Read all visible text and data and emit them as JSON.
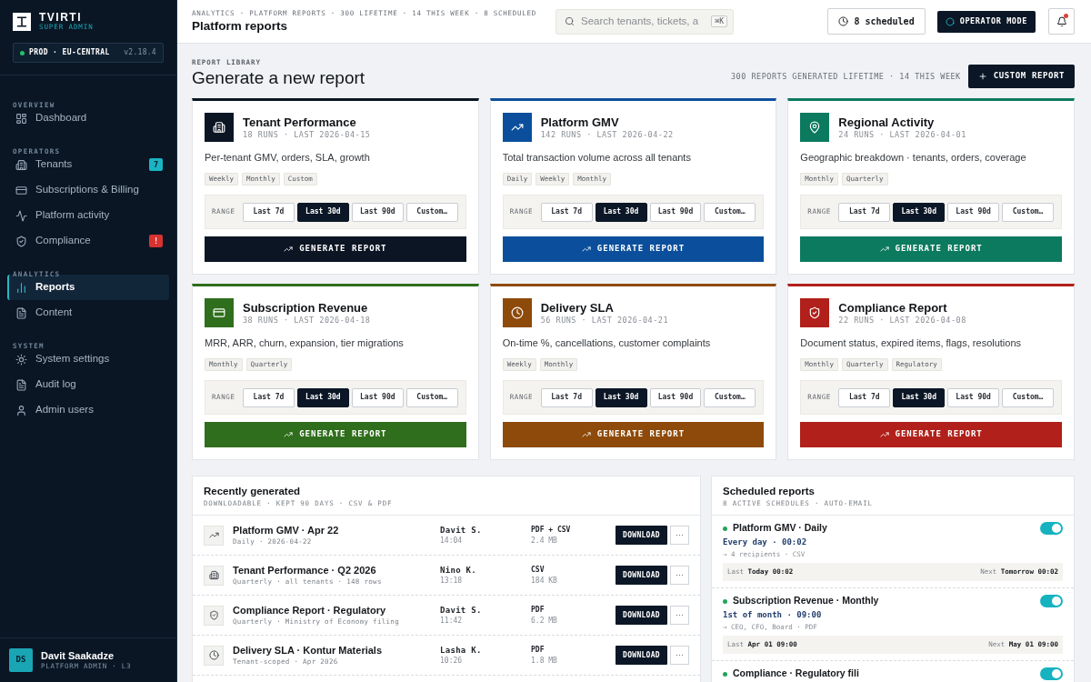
{
  "sidebar": {
    "brand": {
      "name": "TVIRTI",
      "role": "SUPER ADMIN"
    },
    "environment": {
      "name": "PROD · EU-CENTRAL",
      "version": "v2.18.4"
    },
    "sections": [
      {
        "title": "OVERVIEW",
        "items": [
          {
            "label": "Dashboard",
            "selected": false
          }
        ]
      },
      {
        "title": "OPERATORS",
        "items": [
          {
            "label": "Tenants",
            "selected": false,
            "badge": {
              "text": "7",
              "kind": "count"
            }
          },
          {
            "label": "Subscriptions & Billing",
            "selected": false
          },
          {
            "label": "Platform activity",
            "selected": false
          },
          {
            "label": "Compliance",
            "selected": false,
            "badge": {
              "text": "!",
              "kind": "alert"
            }
          }
        ]
      },
      {
        "title": "ANALYTICS",
        "items": [
          {
            "label": "Reports",
            "selected": true
          },
          {
            "label": "Content",
            "selected": false
          }
        ]
      },
      {
        "title": "SYSTEM",
        "items": [
          {
            "label": "System settings",
            "selected": false
          },
          {
            "label": "Audit log",
            "selected": false
          },
          {
            "label": "Admin users",
            "selected": false
          }
        ]
      }
    ],
    "user": {
      "initials": "DS",
      "name": "Davit Saakadze",
      "role": "PLATFORM ADMIN · L3"
    }
  },
  "header": {
    "breadcrumb": "ANALYTICS · PLATFORM REPORTS · 300 LIFETIME · 14 THIS WEEK · 8 SCHEDULED",
    "title": "Platform reports",
    "search": {
      "placeholder": "Search tenants, tickets, a",
      "shortcut": "⌘K"
    },
    "scheduled_button": "8 scheduled",
    "mode_button": "OPERATOR MODE",
    "notifications": {
      "unread": true
    }
  },
  "library": {
    "eyebrow": "REPORT LIBRARY",
    "title": "Generate a new report",
    "summary": "300 REPORTS GENERATED LIFETIME · 14 THIS WEEK",
    "custom_button": "CUSTOM REPORT"
  },
  "report_cards": [
    {
      "title": "Tenant Performance",
      "meta": "18 RUNS · LAST 2026-04-15",
      "description": "Per-tenant GMV, orders, SLA, growth",
      "tags": [
        "Weekly",
        "Monthly",
        "Custom"
      ],
      "color": "#0b1524",
      "range_label": "RANGE",
      "ranges": [
        {
          "label": "Last 7d",
          "selected": false
        },
        {
          "label": "Last 30d",
          "selected": true
        },
        {
          "label": "Last 90d",
          "selected": false
        },
        {
          "label": "Custom…",
          "selected": false
        }
      ],
      "button": "GENERATE REPORT"
    },
    {
      "title": "Platform GMV",
      "meta": "142 RUNS · LAST 2026-04-22",
      "description": "Total transaction volume across all tenants",
      "tags": [
        "Daily",
        "Weekly",
        "Monthly"
      ],
      "color": "#0b4f9c",
      "range_label": "RANGE",
      "ranges": [
        {
          "label": "Last 7d",
          "selected": false
        },
        {
          "label": "Last 30d",
          "selected": true
        },
        {
          "label": "Last 90d",
          "selected": false
        },
        {
          "label": "Custom…",
          "selected": false
        }
      ],
      "button": "GENERATE REPORT"
    },
    {
      "title": "Regional Activity",
      "meta": "24 RUNS · LAST 2026-04-01",
      "description": "Geographic breakdown · tenants, orders, coverage",
      "tags": [
        "Monthly",
        "Quarterly"
      ],
      "color": "#0b7a5f",
      "range_label": "RANGE",
      "ranges": [
        {
          "label": "Last 7d",
          "selected": false
        },
        {
          "label": "Last 30d",
          "selected": true
        },
        {
          "label": "Last 90d",
          "selected": false
        },
        {
          "label": "Custom…",
          "selected": false
        }
      ],
      "button": "GENERATE REPORT"
    },
    {
      "title": "Subscription Revenue",
      "meta": "38 RUNS · LAST 2026-04-18",
      "description": "MRR, ARR, churn, expansion, tier migrations",
      "tags": [
        "Monthly",
        "Quarterly"
      ],
      "color": "#2f6e1c",
      "range_label": "RANGE",
      "ranges": [
        {
          "label": "Last 7d",
          "selected": false
        },
        {
          "label": "Last 30d",
          "selected": true
        },
        {
          "label": "Last 90d",
          "selected": false
        },
        {
          "label": "Custom…",
          "selected": false
        }
      ],
      "button": "GENERATE REPORT"
    },
    {
      "title": "Delivery SLA",
      "meta": "56 RUNS · LAST 2026-04-21",
      "description": "On-time %, cancellations, customer complaints",
      "tags": [
        "Weekly",
        "Monthly"
      ],
      "color": "#8e4a0a",
      "range_label": "RANGE",
      "ranges": [
        {
          "label": "Last 7d",
          "selected": false
        },
        {
          "label": "Last 30d",
          "selected": true
        },
        {
          "label": "Last 90d",
          "selected": false
        },
        {
          "label": "Custom…",
          "selected": false
        }
      ],
      "button": "GENERATE REPORT"
    },
    {
      "title": "Compliance Report",
      "meta": "22 RUNS · LAST 2026-04-08",
      "description": "Document status, expired items, flags, resolutions",
      "tags": [
        "Monthly",
        "Quarterly",
        "Regulatory"
      ],
      "color": "#b1201a",
      "range_label": "RANGE",
      "ranges": [
        {
          "label": "Last 7d",
          "selected": false
        },
        {
          "label": "Last 30d",
          "selected": true
        },
        {
          "label": "Last 90d",
          "selected": false
        },
        {
          "label": "Custom…",
          "selected": false
        }
      ],
      "button": "GENERATE REPORT"
    }
  ],
  "recent": {
    "title": "Recently generated",
    "subtitle": "DOWNLOADABLE · KEPT 90 DAYS · CSV & PDF",
    "rows": [
      {
        "title": "Platform GMV · Apr 22",
        "detail": "Daily · 2026-04-22",
        "user": "Davit S.",
        "time": "14:04",
        "format": "PDF + CSV",
        "size": "2.4 MB",
        "download": "DOWNLOAD",
        "more": "···"
      },
      {
        "title": "Tenant Performance · Q2 2026",
        "detail": "Quarterly · all tenants · 148 rows",
        "user": "Nino K.",
        "time": "13:18",
        "format": "CSV",
        "size": "184 KB",
        "download": "DOWNLOAD",
        "more": "···"
      },
      {
        "title": "Compliance Report · Regulatory",
        "detail": "Quarterly · Ministry of Economy filing",
        "user": "Davit S.",
        "time": "11:42",
        "format": "PDF",
        "size": "6.2 MB",
        "download": "DOWNLOAD",
        "more": "···"
      },
      {
        "title": "Delivery SLA · Kontur Materials",
        "detail": "Tenant-scoped · Apr 2026",
        "user": "Lasha K.",
        "time": "10:26",
        "format": "PDF",
        "size": "1.8 MB",
        "download": "DOWNLOAD",
        "more": "···"
      }
    ]
  },
  "scheduled": {
    "title": "Scheduled reports",
    "subtitle": "8 ACTIVE SCHEDULES · AUTO-EMAIL",
    "items": [
      {
        "title": "Platform GMV · Daily",
        "on": true,
        "cadence": "Every day · 00:02",
        "recipients": "→ 4 recipients · CSV",
        "last": "Last **Today 00:02**",
        "next": "Next **Tomorrow 00:02**"
      },
      {
        "title": "Subscription Revenue · Monthly",
        "on": true,
        "cadence": "1st of month · 09:00",
        "recipients": "→ CEO, CFO, Board · PDF",
        "last": "Last **Apr 01 09:00**",
        "next": "Next **May 01 09:00**"
      },
      {
        "title": "Compliance · Regulatory fili",
        "on": true
      }
    ]
  }
}
